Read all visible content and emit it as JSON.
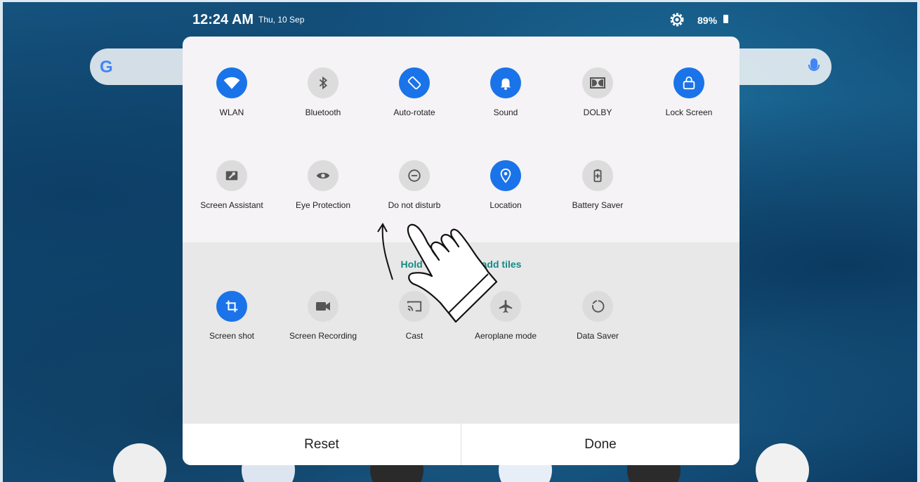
{
  "status_bar": {
    "time": "12:24 AM",
    "date": "Thu, 10 Sep",
    "battery": "89%",
    "icons": [
      "settings-gear-icon",
      "battery-icon"
    ]
  },
  "search_bar": {
    "logo": "G",
    "icons": [
      "google-logo",
      "microphone-icon"
    ]
  },
  "active_tiles": [
    {
      "label": "WLAN",
      "icon": "wifi-icon",
      "on": true
    },
    {
      "label": "Bluetooth",
      "icon": "bluetooth-icon",
      "on": false
    },
    {
      "label": "Auto-rotate",
      "icon": "auto-rotate-icon",
      "on": true
    },
    {
      "label": "Sound",
      "icon": "bell-icon",
      "on": true
    },
    {
      "label": "DOLBY",
      "icon": "dolby-icon",
      "on": false
    },
    {
      "label": "Lock Screen",
      "icon": "lock-icon",
      "on": true
    },
    {
      "label": "Screen Assistant",
      "icon": "wrench-icon",
      "on": false
    },
    {
      "label": "Eye Protection",
      "icon": "eye-icon",
      "on": false
    },
    {
      "label": "Do not disturb",
      "icon": "do-not-disturb-icon",
      "on": false
    },
    {
      "label": "Location",
      "icon": "location-pin-icon",
      "on": true
    },
    {
      "label": "Battery Saver",
      "icon": "battery-saver-icon",
      "on": false
    }
  ],
  "hint": "Hold and drag to add tiles",
  "available_tiles": [
    {
      "label": "Screen shot",
      "icon": "crop-icon",
      "on": true
    },
    {
      "label": "Screen Recording",
      "icon": "video-camera-icon",
      "on": false
    },
    {
      "label": "Cast",
      "icon": "cast-icon",
      "on": false
    },
    {
      "label": "Aeroplane mode",
      "icon": "airplane-icon",
      "on": false
    },
    {
      "label": "Data Saver",
      "icon": "data-saver-icon",
      "on": false
    }
  ],
  "buttons": {
    "reset": "Reset",
    "done": "Done"
  },
  "colors": {
    "active": "#1a73e8",
    "inactive": "#dcdcdc",
    "hint": "#138a85",
    "panel": "#f5f3f5"
  }
}
